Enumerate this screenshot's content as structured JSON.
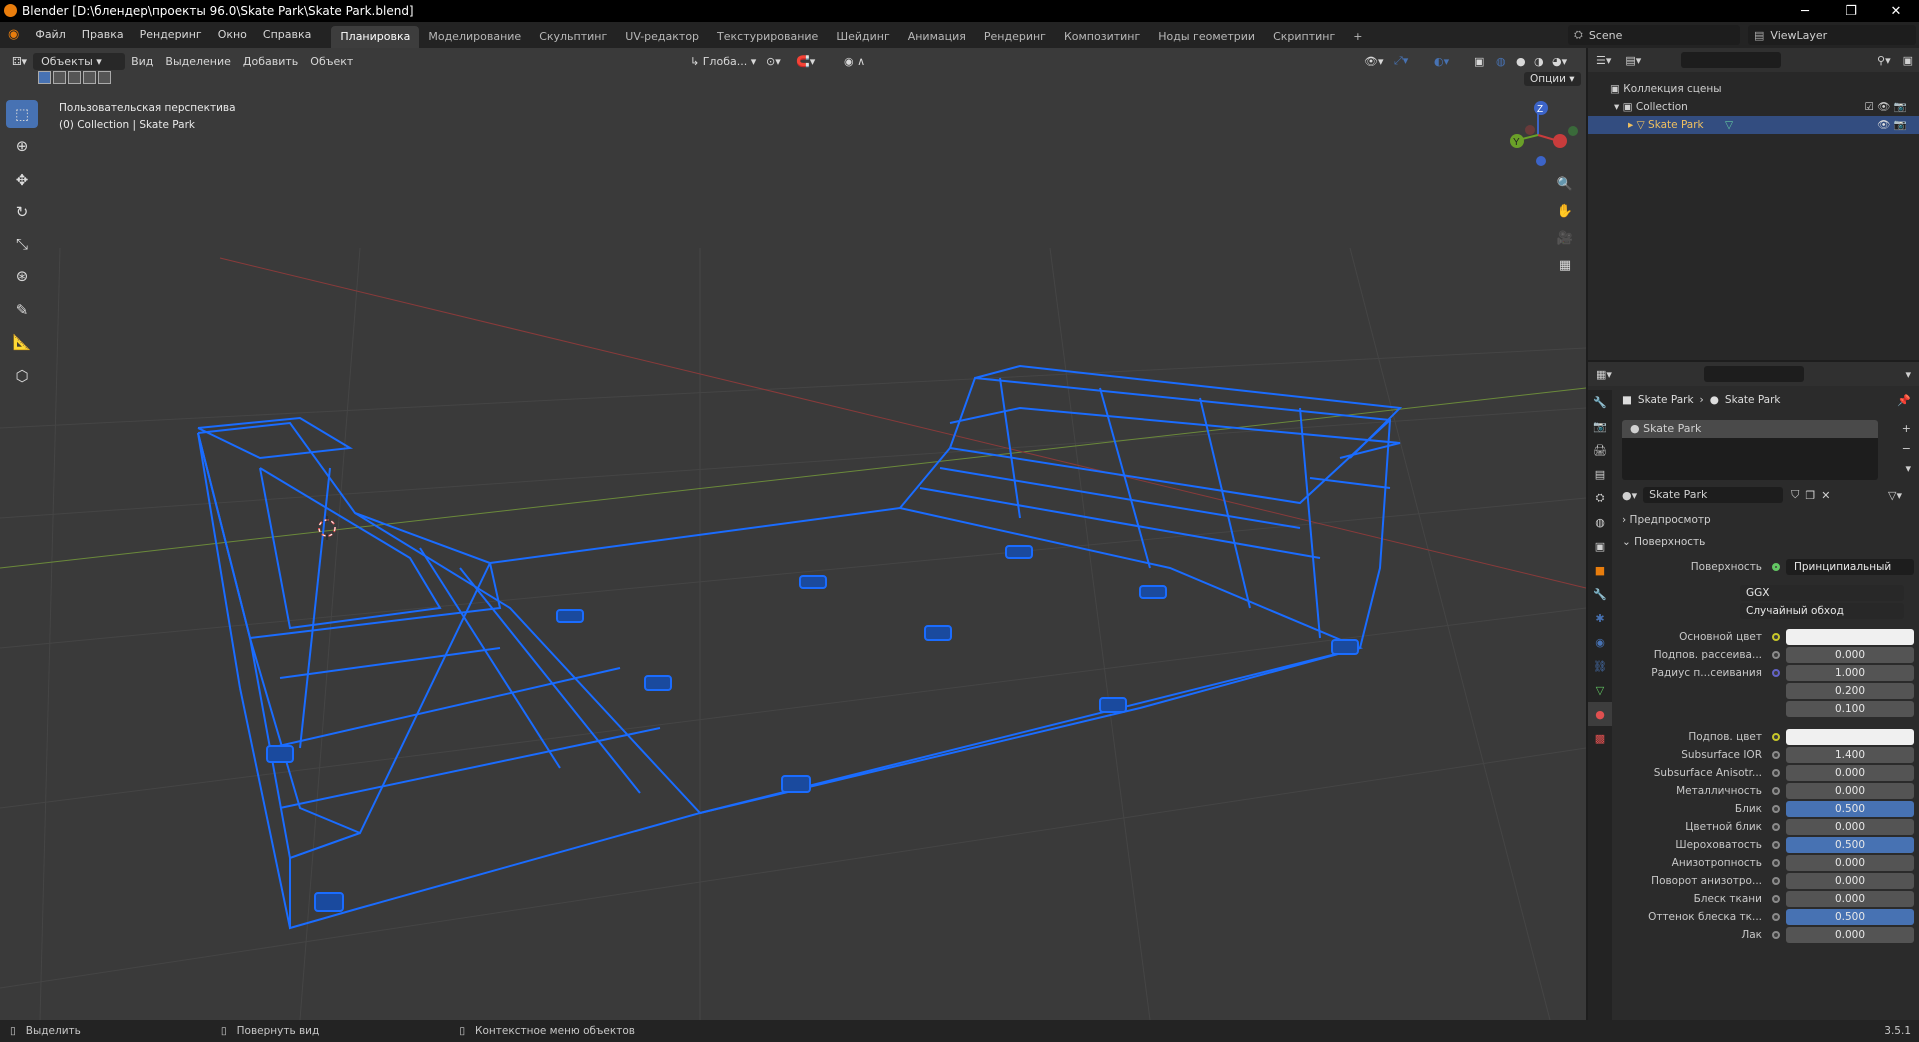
{
  "window": {
    "title": "Blender [D:\\блендер\\проекты 96.0\\Skate Park\\Skate Park.blend]"
  },
  "menu": [
    "Файл",
    "Правка",
    "Рендеринг",
    "Окно",
    "Справка"
  ],
  "workspaces": [
    "Планировка",
    "Моделирование",
    "Скульптинг",
    "UV-редактор",
    "Текстурирование",
    "Шейдинг",
    "Анимация",
    "Рендеринг",
    "Композитинг",
    "Ноды геометрии",
    "Скриптинг"
  ],
  "active_workspace": "Планировка",
  "scene": {
    "name": "Scene",
    "view_layer": "ViewLayer"
  },
  "viewport": {
    "mode": "Объекты",
    "menus": [
      "Вид",
      "Выделение",
      "Добавить",
      "Объект"
    ],
    "transform_orientation": "Глоба...",
    "options": "Опции",
    "view_name": "Пользовательская перспектива",
    "collection_info": "(0) Collection | Skate Park"
  },
  "outliner": {
    "root": "Коллекция сцены",
    "collection": "Collection",
    "object": "Skate Park"
  },
  "properties": {
    "breadcrumb": [
      "Skate Park",
      "Skate Park"
    ],
    "material_slot": "Skate Park",
    "material_name": "Skate Park",
    "panels": {
      "preview": "Предпросмотр",
      "surface": "Поверхность"
    },
    "surface_label": "Поверхность",
    "surface_value": "Принципиальный BSDF",
    "distribution": "GGX",
    "subsurface_method": "Случайный обход",
    "rows": [
      {
        "label": "Основной цвет",
        "value": "",
        "style": "white",
        "dot": "yellow"
      },
      {
        "label": "Подпов. рассеива...",
        "value": "0.000",
        "style": "gray",
        "dot": "gray"
      },
      {
        "label": "Радиус п...сеивания",
        "value": "1.000",
        "style": "gray",
        "dot": "purple"
      },
      {
        "label": "",
        "value": "0.200",
        "style": "gray",
        "dot": ""
      },
      {
        "label": "",
        "value": "0.100",
        "style": "gray",
        "dot": ""
      },
      {
        "label": "Подпов. цвет",
        "value": "",
        "style": "white",
        "dot": "yellow"
      },
      {
        "label": "Subsurface IOR",
        "value": "1.400",
        "style": "gray",
        "dot": "gray"
      },
      {
        "label": "Subsurface Anisotr...",
        "value": "0.000",
        "style": "gray",
        "dot": "gray"
      },
      {
        "label": "Металличность",
        "value": "0.000",
        "style": "gray",
        "dot": "gray"
      },
      {
        "label": "Блик",
        "value": "0.500",
        "style": "blue",
        "dot": "gray"
      },
      {
        "label": "Цветной блик",
        "value": "0.000",
        "style": "gray",
        "dot": "gray"
      },
      {
        "label": "Шероховатость",
        "value": "0.500",
        "style": "blue",
        "dot": "gray"
      },
      {
        "label": "Анизотропность",
        "value": "0.000",
        "style": "gray",
        "dot": "gray"
      },
      {
        "label": "Поворот анизотро...",
        "value": "0.000",
        "style": "gray",
        "dot": "gray"
      },
      {
        "label": "Блеск ткани",
        "value": "0.000",
        "style": "gray",
        "dot": "gray"
      },
      {
        "label": "Оттенок блеска тк...",
        "value": "0.500",
        "style": "blue",
        "dot": "gray"
      },
      {
        "label": "Лак",
        "value": "0.000",
        "style": "gray",
        "dot": "gray"
      }
    ]
  },
  "statusbar": {
    "select": "Выделить",
    "rotate": "Повернуть вид",
    "context": "Контекстное меню объектов",
    "version": "3.5.1"
  },
  "colors": {
    "accent": "#4772b3",
    "wireframe": "#1a6cff",
    "viewport_bg": "#3a3a3a"
  }
}
